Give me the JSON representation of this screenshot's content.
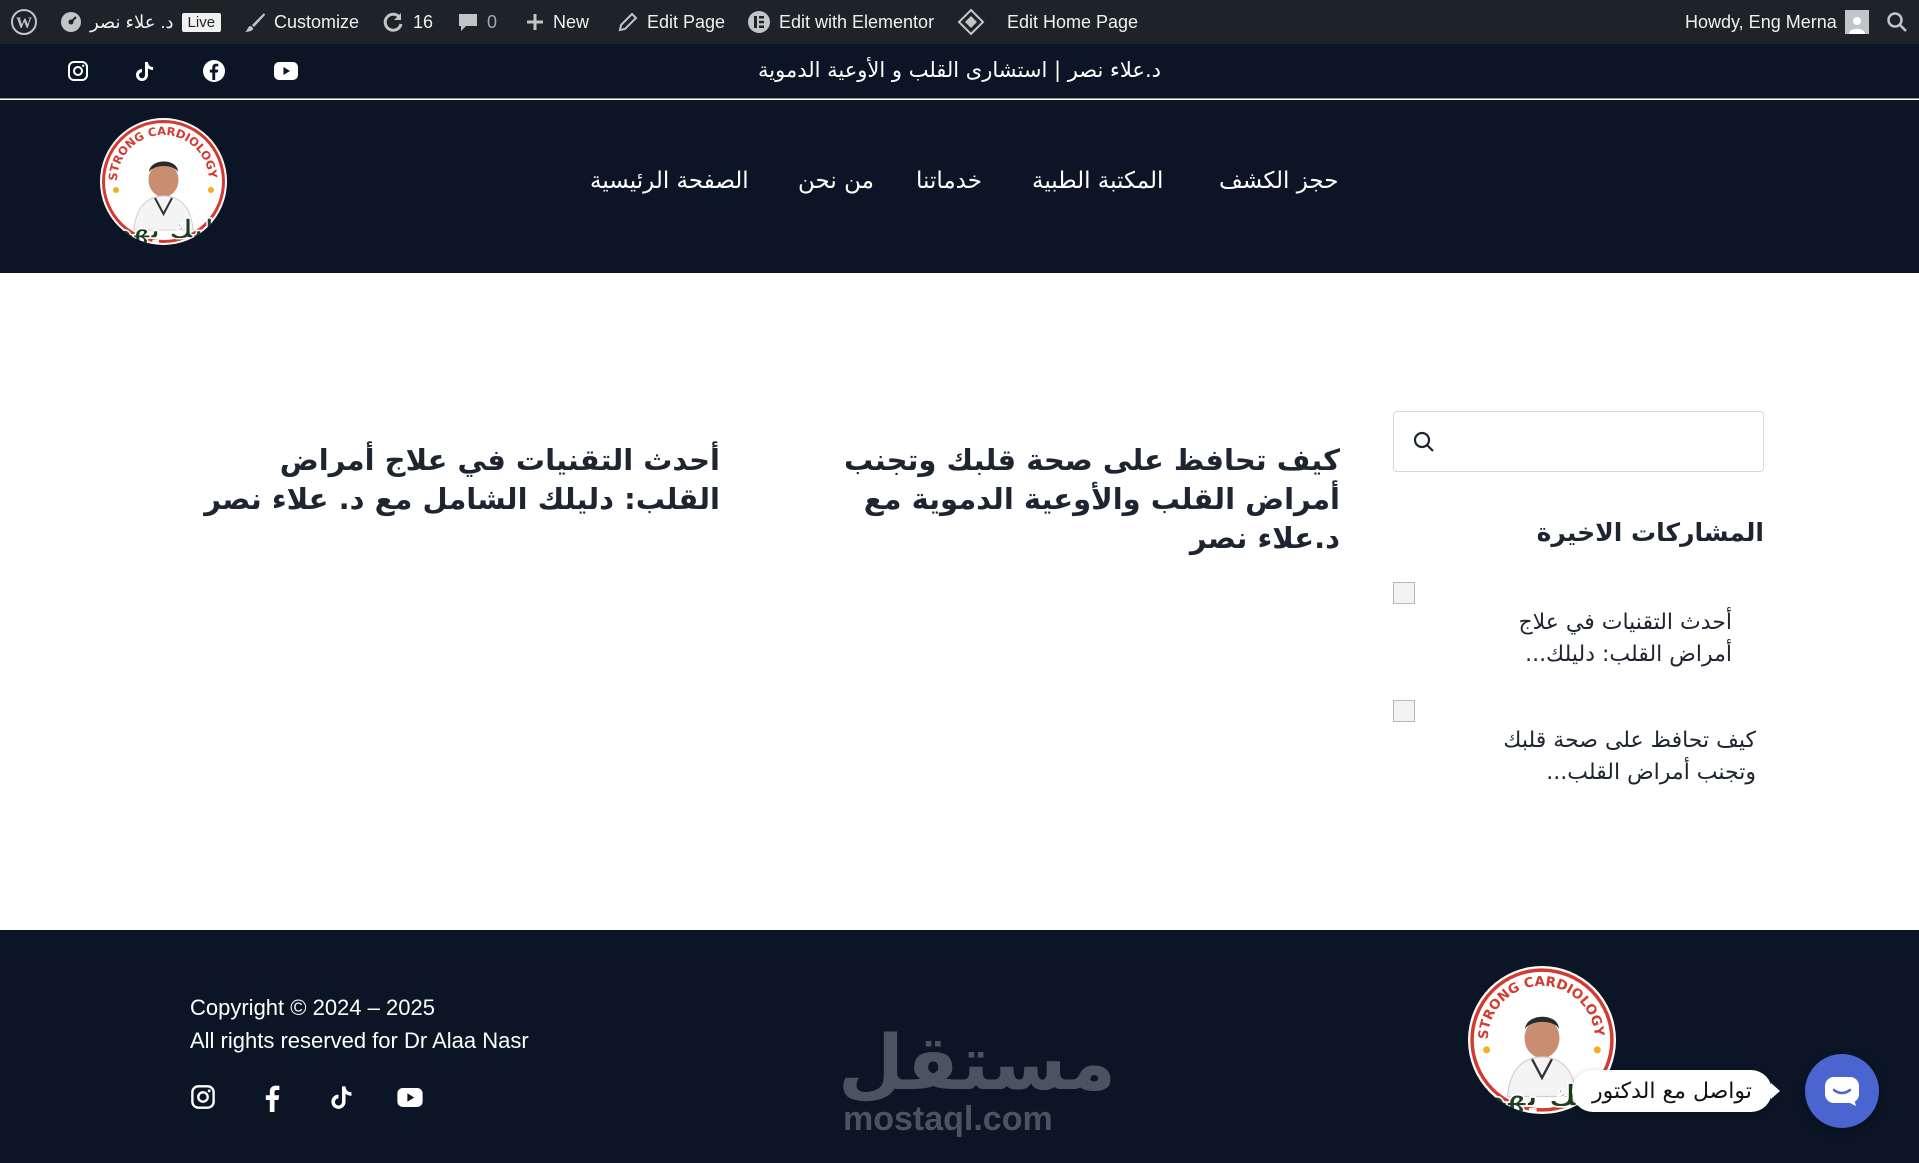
{
  "admin_bar": {
    "site_name": "د. علاء نصر",
    "live_label": "Live",
    "customize_label": "Customize",
    "updates_count": "16",
    "comments_count": "0",
    "new_label": "New",
    "edit_page_label": "Edit Page",
    "edit_elementor_label": "Edit with Elementor",
    "edit_home_label": "Edit Home Page",
    "greeting": "Howdy, Eng Merna"
  },
  "topbar": {
    "tagline": "د.علاء نصر | استشارى القلب و الأوعية الدموية",
    "social": [
      "instagram-icon",
      "tiktok-icon",
      "facebook-icon",
      "youtube-icon"
    ]
  },
  "logo": {
    "ring_text": "STRONG CARDIOLOGY",
    "brand_text": "قلبك يهمنا"
  },
  "nav": {
    "items": [
      "حجز الكشف",
      "المكتبة الطبية",
      "خدماتنا",
      "من نحن",
      "الصفحة الرئيسية"
    ]
  },
  "posts": [
    {
      "title": "كيف تحافظ على صحة قلبك وتجنب أمراض القلب والأوعية الدموية مع د.علاء نصر"
    },
    {
      "title": "أحدث التقنيات في علاج أمراض القلب: دليلك الشامل مع د. علاء نصر"
    }
  ],
  "sidebar": {
    "search_placeholder": "",
    "recent_heading": "المشاركات الاخيرة",
    "recent": [
      {
        "title": "أحدث التقنيات في علاج أمراض القلب: دليلك..."
      },
      {
        "title": "كيف تحافظ على صحة قلبك وتجنب أمراض القلب..."
      }
    ]
  },
  "footer": {
    "copyright": "Copyright © 2024 – 2025",
    "rights": "All rights reserved for Dr Alaa Nasr",
    "social": [
      "instagram-icon",
      "facebook-icon",
      "tiktok-icon",
      "youtube-icon"
    ],
    "watermark_ar": "مستقل",
    "watermark_en": "mostaql.com"
  },
  "chat": {
    "label": "تواصل مع الدكتور"
  },
  "colors": {
    "navy": "#0b1526",
    "admin_bar": "#1d2327",
    "chat_button": "#4a64d0",
    "heading_text": "#1f2530"
  }
}
